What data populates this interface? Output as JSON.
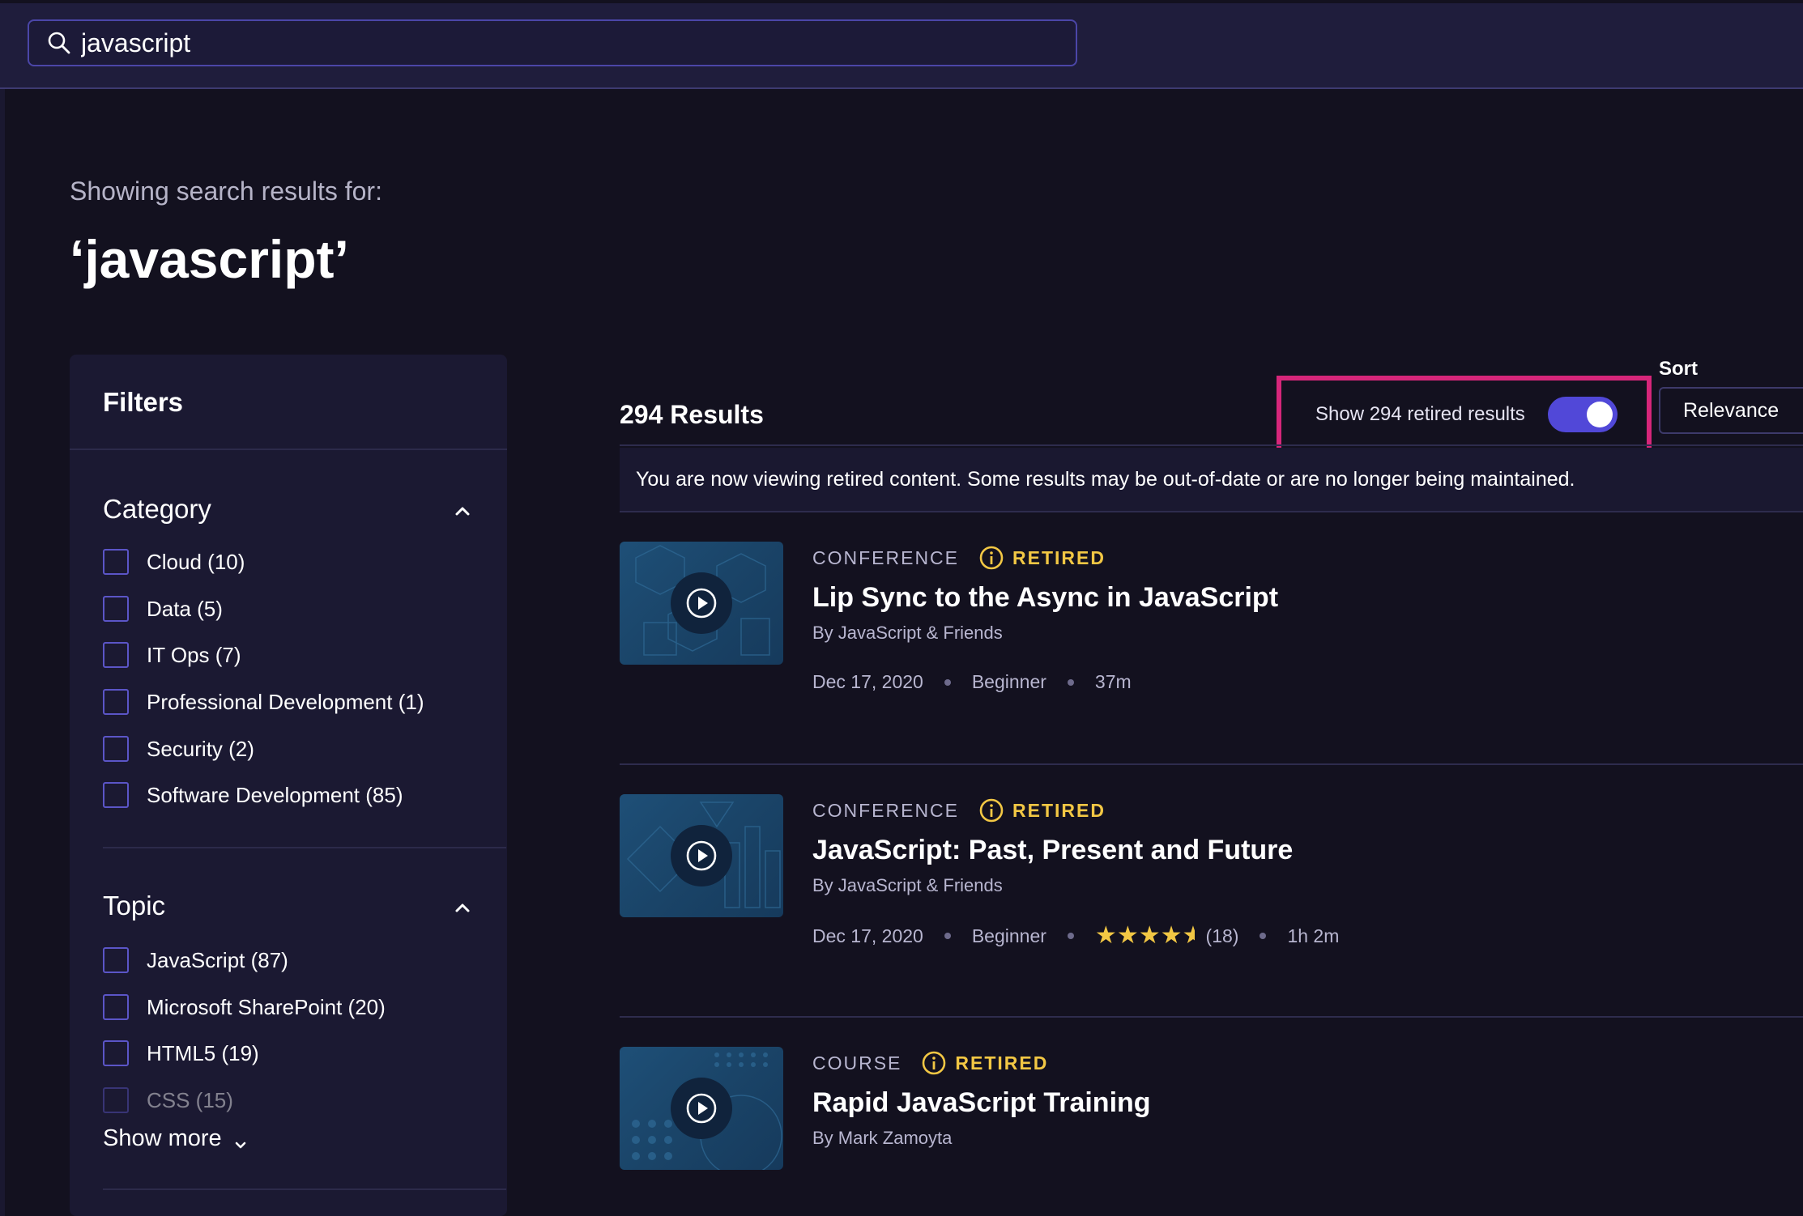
{
  "search": {
    "value": "javascript",
    "placeholder": ""
  },
  "heading": {
    "showing": "Showing search results for:",
    "query": "‘javascript’"
  },
  "filters": {
    "title": "Filters",
    "category": {
      "title": "Category",
      "items": [
        {
          "label": "Cloud (10)"
        },
        {
          "label": "Data (5)"
        },
        {
          "label": "IT Ops (7)"
        },
        {
          "label": "Professional Development (1)"
        },
        {
          "label": "Security (2)"
        },
        {
          "label": "Software Development (85)"
        }
      ]
    },
    "topic": {
      "title": "Topic",
      "items": [
        {
          "label": "JavaScript (87)"
        },
        {
          "label": "Microsoft SharePoint (20)"
        },
        {
          "label": "HTML5 (19)"
        },
        {
          "label": "CSS (15)"
        }
      ]
    },
    "show_more": "Show more"
  },
  "results": {
    "count": "294 Results",
    "retired_toggle_label": "Show 294 retired results",
    "retired_toggle_on": true,
    "sort_label": "Sort",
    "sort_value": "Relevance",
    "notice": "You are now viewing retired content. Some results may be out-of-date or are no longer being maintained.",
    "items": [
      {
        "type": "CONFERENCE",
        "status": "RETIRED",
        "title": "Lip Sync to the Async in JavaScript",
        "author": "By JavaScript & Friends",
        "date": "Dec 17, 2020",
        "level": "Beginner",
        "duration": "37m"
      },
      {
        "type": "CONFERENCE",
        "status": "RETIRED",
        "title": "JavaScript: Past, Present and Future",
        "author": "By JavaScript & Friends",
        "date": "Dec 17, 2020",
        "level": "Beginner",
        "rating": 4.5,
        "rating_count": "(18)",
        "duration": "1h 2m"
      },
      {
        "type": "COURSE",
        "status": "RETIRED",
        "title": "Rapid JavaScript Training",
        "author": "By Mark Zamoyta"
      }
    ]
  },
  "colors": {
    "background": "#13111f",
    "topbar": "#1f1d3c",
    "accent": "#5148d8",
    "highlight_border": "#d6267a",
    "retired_tag": "#f2c744",
    "star": "#f2c744"
  }
}
